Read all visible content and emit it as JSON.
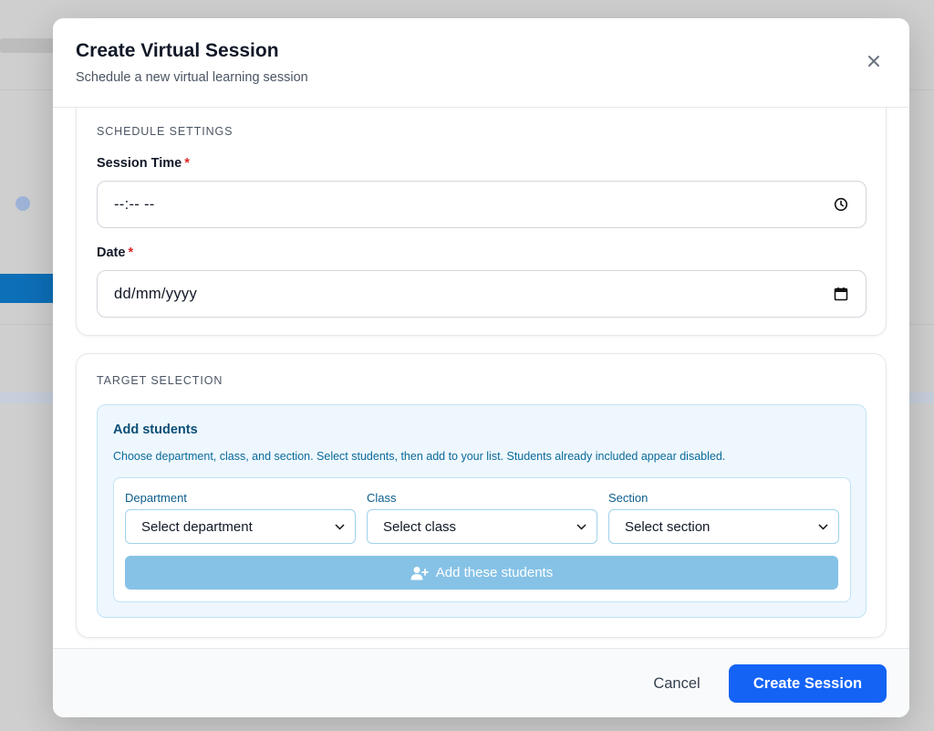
{
  "modal": {
    "title": "Create Virtual Session",
    "subtitle": "Schedule a new virtual learning session",
    "close_icon": "close-icon"
  },
  "schedule": {
    "heading": "SCHEDULE SETTINGS",
    "session_time": {
      "label": "Session Time",
      "required_mark": "*",
      "value": "--:-- --",
      "icon": "clock-icon"
    },
    "date": {
      "label": "Date",
      "required_mark": "*",
      "value": "dd/mm/yyyy",
      "icon": "calendar-icon"
    }
  },
  "target": {
    "heading": "TARGET SELECTION",
    "add_students": {
      "title": "Add students",
      "description": "Choose department, class, and section. Select students, then add to your list. Students already included appear disabled.",
      "department": {
        "label": "Department",
        "value": "Select department"
      },
      "class": {
        "label": "Class",
        "value": "Select class"
      },
      "section": {
        "label": "Section",
        "value": "Select section"
      },
      "add_button": {
        "label": "Add these students",
        "icon": "user-plus-icon"
      }
    }
  },
  "footer": {
    "cancel_label": "Cancel",
    "create_label": "Create Session"
  },
  "colors": {
    "primary": "#1463f5",
    "add_button_disabled": "#86c2e6",
    "panel_bg": "#eef7fd",
    "required": "#dc2626"
  }
}
